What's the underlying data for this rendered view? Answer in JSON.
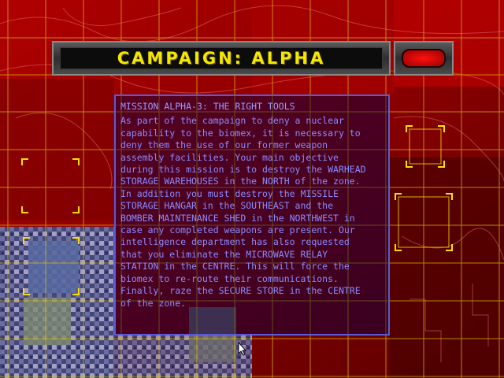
{
  "header": {
    "title": "CAMPAIGN: ALPHA"
  },
  "briefing": {
    "title": "MISSION ALPHA-3: THE RIGHT TOOLS",
    "body": "As part of the campaign to deny a nuclear\ncapability to the biomex, it is necessary to\ndeny them the use of our former weapon\nassembly facilities. Your main objective\nduring this mission is to destroy the WARHEAD\nSTORAGE WAREHOUSES in the NORTH of the zone.\nIn addition you must destroy the MISSILE\nSTORAGE HANGAR in the SOUTHEAST and the\nBOMBER MAINTENANCE SHED in the NORTHWEST in\ncase any completed weapons are present. Our\nintelligence department has also requested\nthat you eliminate the MICROWAVE RELAY\nSTATION in the CENTRE. This will force the\nbiomex to re-route their communications.\nFinally, raze the SECURE STORE in the CENTRE\nof the zone."
  },
  "colors": {
    "background": "#7a0000",
    "grid": "#e0c000",
    "title": "#f3e600",
    "briefing_text": "#8c8cff",
    "briefing_border": "#5a5ad8"
  },
  "icons": {
    "close": "red-lamp-button-icon",
    "pointer": "mouse-cursor-icon"
  }
}
